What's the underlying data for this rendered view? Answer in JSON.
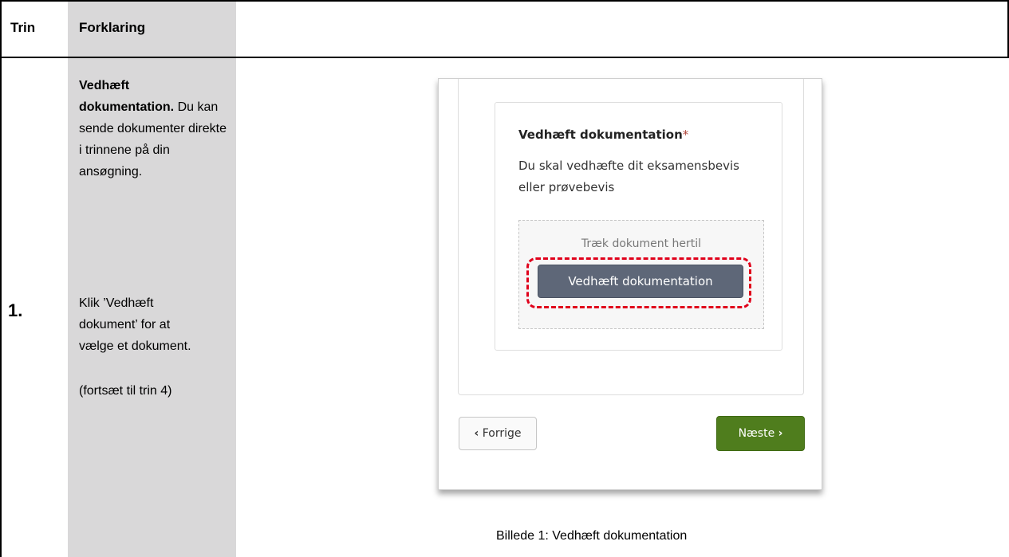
{
  "header": {
    "col1": "Trin",
    "col2": "Forklaring"
  },
  "step": {
    "number": "1.",
    "title": "Vedhæft dokumentation.",
    "intro": "Du kan sende dokumenter direkte i trinnene på din ansøgning.",
    "instruction": "Klik ’Vedhæft dokument’ for at vælge et dokument.",
    "note": "(fortsæt til trin 4)"
  },
  "screenshot": {
    "field_title": "Vedhæft dokumentation",
    "required_mark": "*",
    "field_description": "Du skal vedhæfte dit eksamensbevis eller prøvebevis",
    "drop_text": "Træk dokument hertil",
    "attach_button": "Vedhæft dokumentation",
    "prev_button": "Forrige",
    "prev_icon": "‹",
    "next_button": "Næste",
    "next_icon": "›"
  },
  "caption": "Billede 1: Vedhæft dokumentation",
  "colors": {
    "grey_column": "#d9d8d9",
    "highlight": "#e0001b",
    "attach_button": "#5e6778",
    "next_button": "#4f7d1d"
  }
}
